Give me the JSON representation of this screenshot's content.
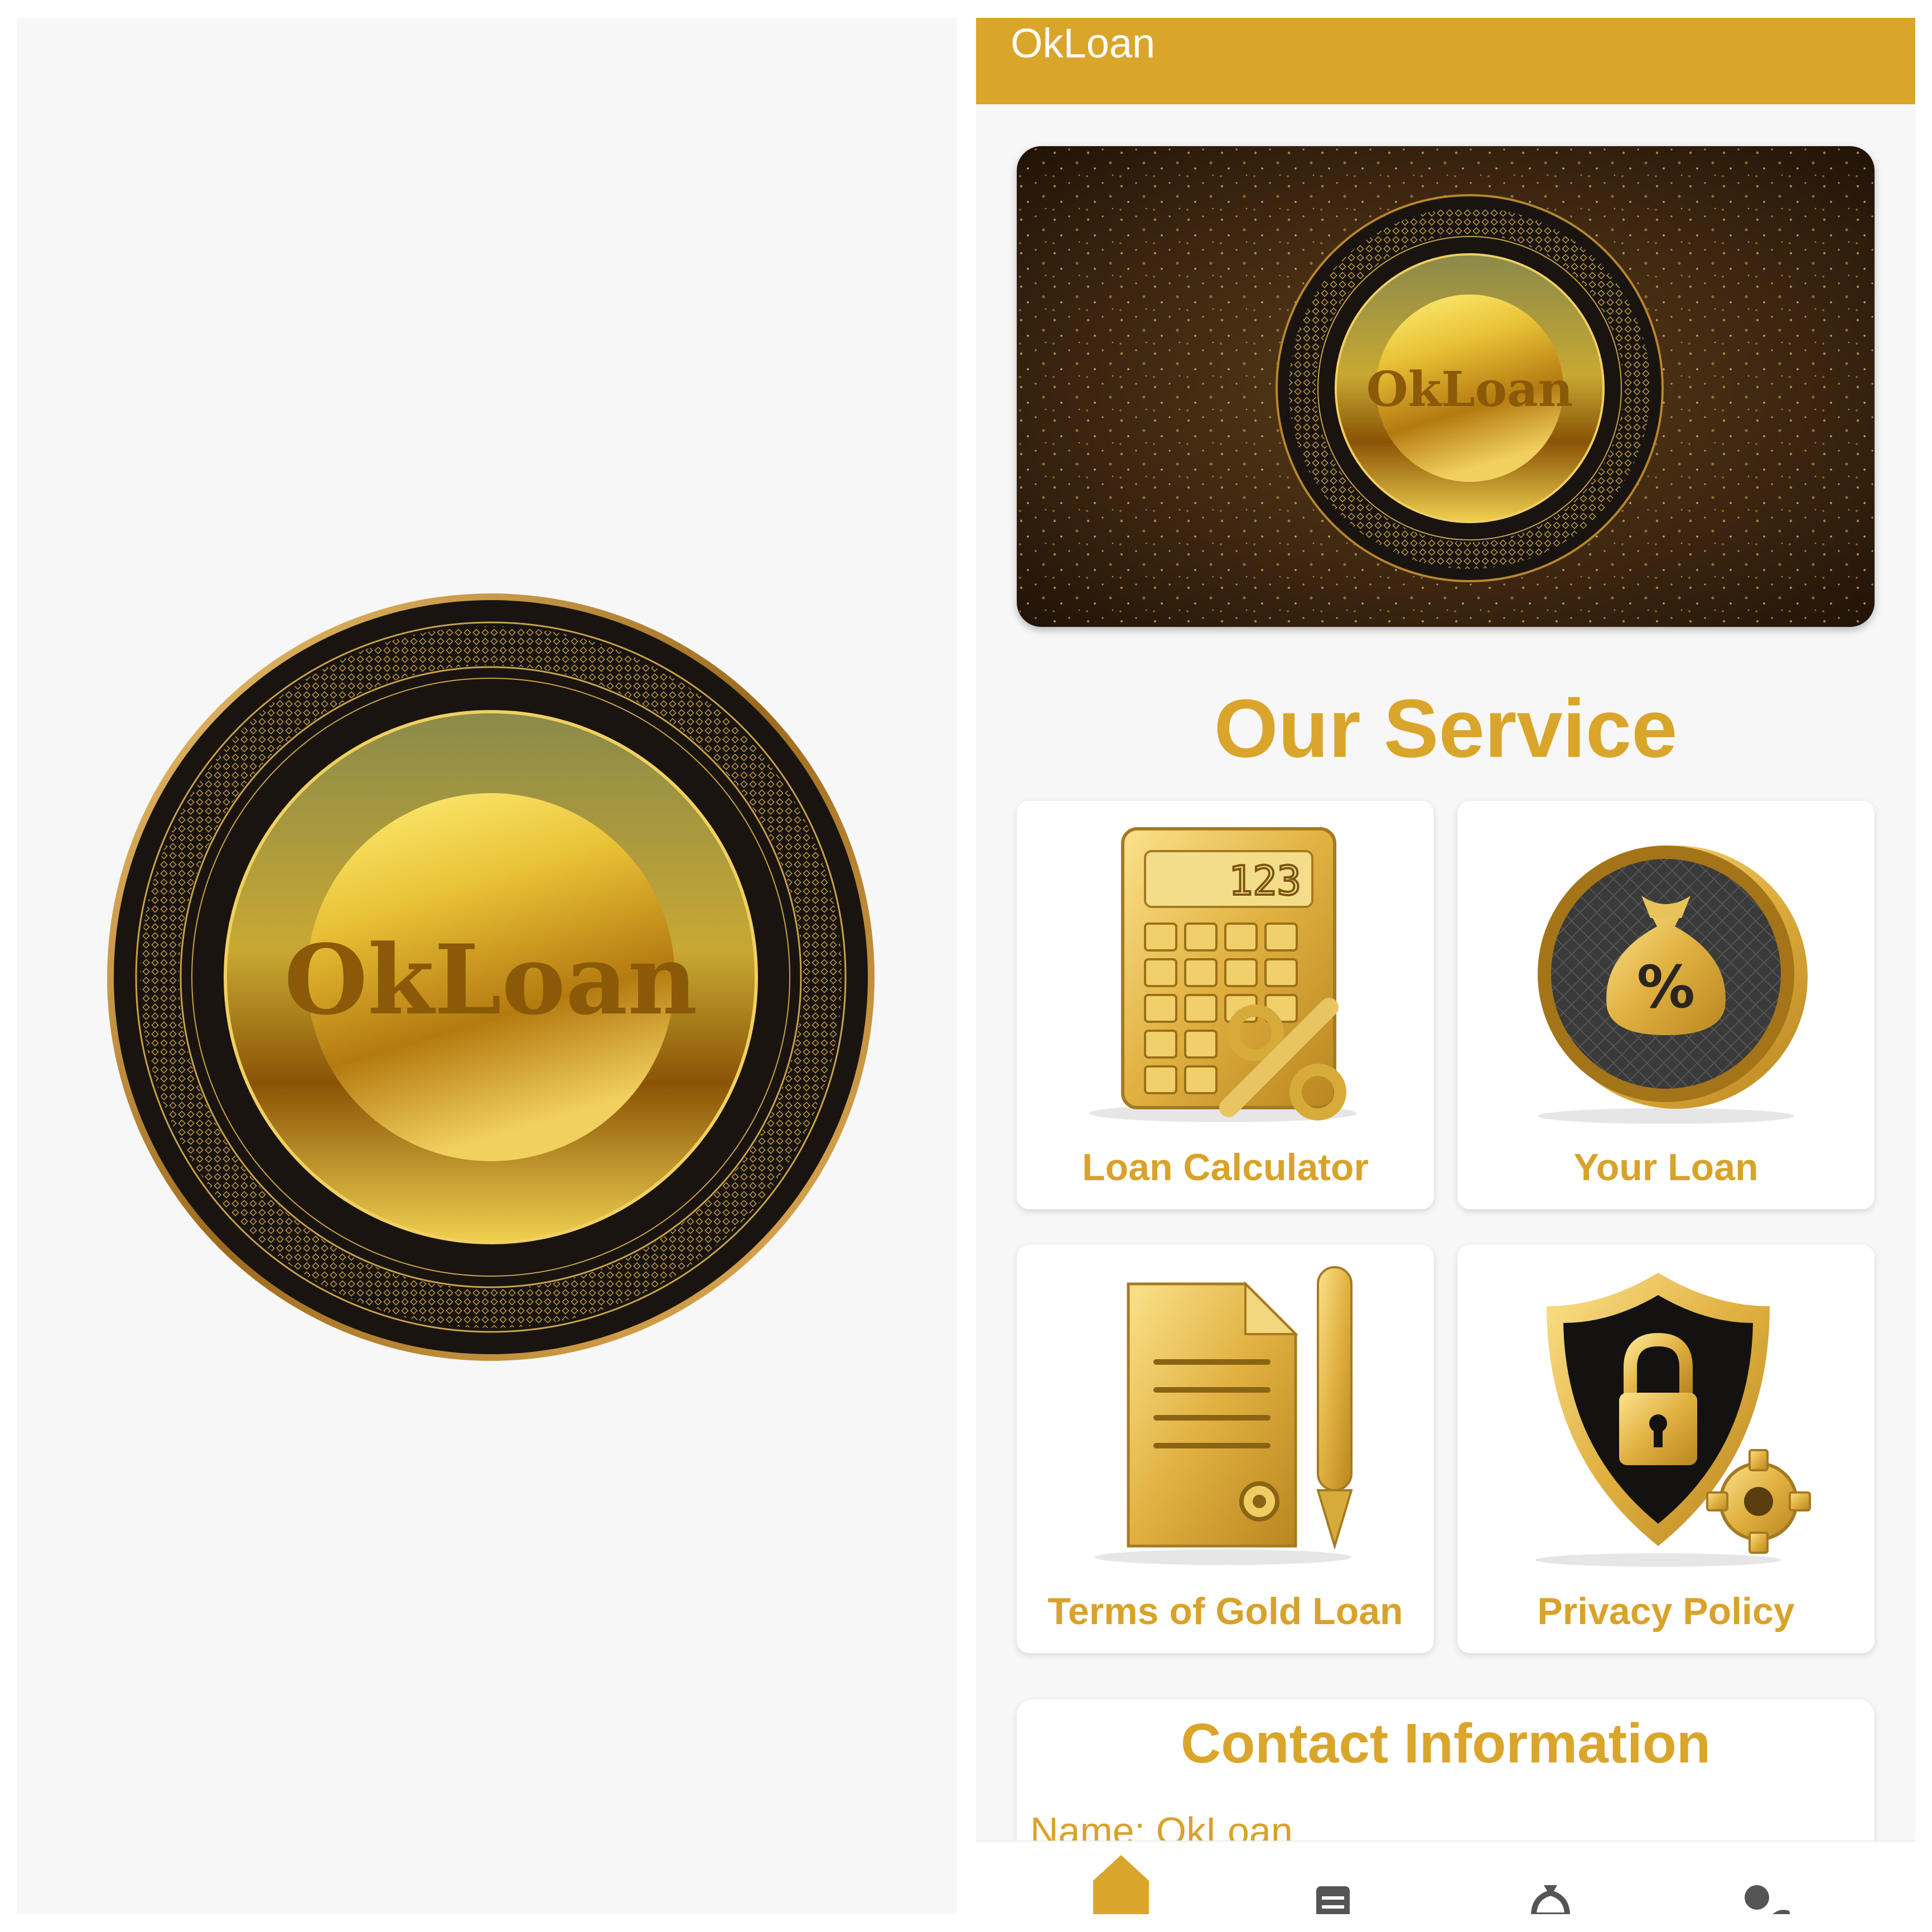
{
  "splash": {
    "logo_text": "OkLoan"
  },
  "home": {
    "app_bar": {
      "title": "OkLoan"
    },
    "banner": {
      "logo_text": "OkLoan"
    },
    "section_title": "Our Service",
    "services": [
      {
        "label": "Loan Calculator",
        "icon": "calculator-icon",
        "display_text": "123"
      },
      {
        "label": "Your Loan",
        "icon": "money-bag-icon",
        "symbol": "%"
      },
      {
        "label": "Terms of Gold Loan",
        "icon": "document-icon"
      },
      {
        "label": "Privacy Policy",
        "icon": "shield-lock-icon"
      }
    ],
    "contact": {
      "title": "Contact Information",
      "name": "Name: OkLoan"
    },
    "bottom_nav": [
      {
        "icon": "home-icon",
        "active": true
      },
      {
        "icon": "list-icon",
        "active": false
      },
      {
        "icon": "loan-icon",
        "active": false
      },
      {
        "icon": "profile-icon",
        "active": false
      }
    ]
  },
  "colors": {
    "brand_gold": "#daa52b",
    "card_background": "#ffffff",
    "page_background": "#f7f7f7",
    "coin_dark": "#1a1410"
  }
}
